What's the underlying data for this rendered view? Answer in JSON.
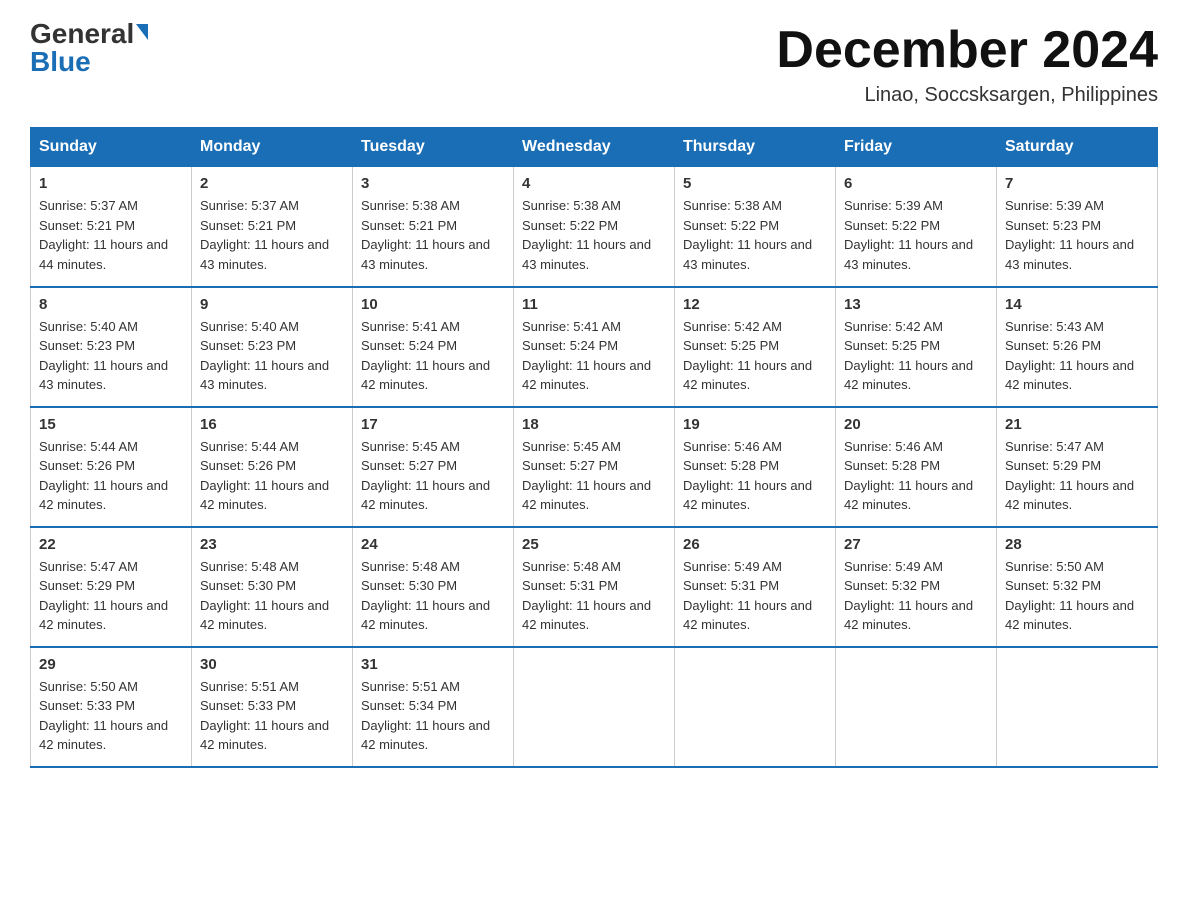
{
  "header": {
    "logo_general": "General",
    "logo_blue": "Blue",
    "month_title": "December 2024",
    "location": "Linao, Soccsksargen, Philippines"
  },
  "days_of_week": [
    "Sunday",
    "Monday",
    "Tuesday",
    "Wednesday",
    "Thursday",
    "Friday",
    "Saturday"
  ],
  "weeks": [
    [
      {
        "day": "1",
        "sunrise": "5:37 AM",
        "sunset": "5:21 PM",
        "daylight": "11 hours and 44 minutes."
      },
      {
        "day": "2",
        "sunrise": "5:37 AM",
        "sunset": "5:21 PM",
        "daylight": "11 hours and 43 minutes."
      },
      {
        "day": "3",
        "sunrise": "5:38 AM",
        "sunset": "5:21 PM",
        "daylight": "11 hours and 43 minutes."
      },
      {
        "day": "4",
        "sunrise": "5:38 AM",
        "sunset": "5:22 PM",
        "daylight": "11 hours and 43 minutes."
      },
      {
        "day": "5",
        "sunrise": "5:38 AM",
        "sunset": "5:22 PM",
        "daylight": "11 hours and 43 minutes."
      },
      {
        "day": "6",
        "sunrise": "5:39 AM",
        "sunset": "5:22 PM",
        "daylight": "11 hours and 43 minutes."
      },
      {
        "day": "7",
        "sunrise": "5:39 AM",
        "sunset": "5:23 PM",
        "daylight": "11 hours and 43 minutes."
      }
    ],
    [
      {
        "day": "8",
        "sunrise": "5:40 AM",
        "sunset": "5:23 PM",
        "daylight": "11 hours and 43 minutes."
      },
      {
        "day": "9",
        "sunrise": "5:40 AM",
        "sunset": "5:23 PM",
        "daylight": "11 hours and 43 minutes."
      },
      {
        "day": "10",
        "sunrise": "5:41 AM",
        "sunset": "5:24 PM",
        "daylight": "11 hours and 42 minutes."
      },
      {
        "day": "11",
        "sunrise": "5:41 AM",
        "sunset": "5:24 PM",
        "daylight": "11 hours and 42 minutes."
      },
      {
        "day": "12",
        "sunrise": "5:42 AM",
        "sunset": "5:25 PM",
        "daylight": "11 hours and 42 minutes."
      },
      {
        "day": "13",
        "sunrise": "5:42 AM",
        "sunset": "5:25 PM",
        "daylight": "11 hours and 42 minutes."
      },
      {
        "day": "14",
        "sunrise": "5:43 AM",
        "sunset": "5:26 PM",
        "daylight": "11 hours and 42 minutes."
      }
    ],
    [
      {
        "day": "15",
        "sunrise": "5:44 AM",
        "sunset": "5:26 PM",
        "daylight": "11 hours and 42 minutes."
      },
      {
        "day": "16",
        "sunrise": "5:44 AM",
        "sunset": "5:26 PM",
        "daylight": "11 hours and 42 minutes."
      },
      {
        "day": "17",
        "sunrise": "5:45 AM",
        "sunset": "5:27 PM",
        "daylight": "11 hours and 42 minutes."
      },
      {
        "day": "18",
        "sunrise": "5:45 AM",
        "sunset": "5:27 PM",
        "daylight": "11 hours and 42 minutes."
      },
      {
        "day": "19",
        "sunrise": "5:46 AM",
        "sunset": "5:28 PM",
        "daylight": "11 hours and 42 minutes."
      },
      {
        "day": "20",
        "sunrise": "5:46 AM",
        "sunset": "5:28 PM",
        "daylight": "11 hours and 42 minutes."
      },
      {
        "day": "21",
        "sunrise": "5:47 AM",
        "sunset": "5:29 PM",
        "daylight": "11 hours and 42 minutes."
      }
    ],
    [
      {
        "day": "22",
        "sunrise": "5:47 AM",
        "sunset": "5:29 PM",
        "daylight": "11 hours and 42 minutes."
      },
      {
        "day": "23",
        "sunrise": "5:48 AM",
        "sunset": "5:30 PM",
        "daylight": "11 hours and 42 minutes."
      },
      {
        "day": "24",
        "sunrise": "5:48 AM",
        "sunset": "5:30 PM",
        "daylight": "11 hours and 42 minutes."
      },
      {
        "day": "25",
        "sunrise": "5:48 AM",
        "sunset": "5:31 PM",
        "daylight": "11 hours and 42 minutes."
      },
      {
        "day": "26",
        "sunrise": "5:49 AM",
        "sunset": "5:31 PM",
        "daylight": "11 hours and 42 minutes."
      },
      {
        "day": "27",
        "sunrise": "5:49 AM",
        "sunset": "5:32 PM",
        "daylight": "11 hours and 42 minutes."
      },
      {
        "day": "28",
        "sunrise": "5:50 AM",
        "sunset": "5:32 PM",
        "daylight": "11 hours and 42 minutes."
      }
    ],
    [
      {
        "day": "29",
        "sunrise": "5:50 AM",
        "sunset": "5:33 PM",
        "daylight": "11 hours and 42 minutes."
      },
      {
        "day": "30",
        "sunrise": "5:51 AM",
        "sunset": "5:33 PM",
        "daylight": "11 hours and 42 minutes."
      },
      {
        "day": "31",
        "sunrise": "5:51 AM",
        "sunset": "5:34 PM",
        "daylight": "11 hours and 42 minutes."
      },
      null,
      null,
      null,
      null
    ]
  ]
}
